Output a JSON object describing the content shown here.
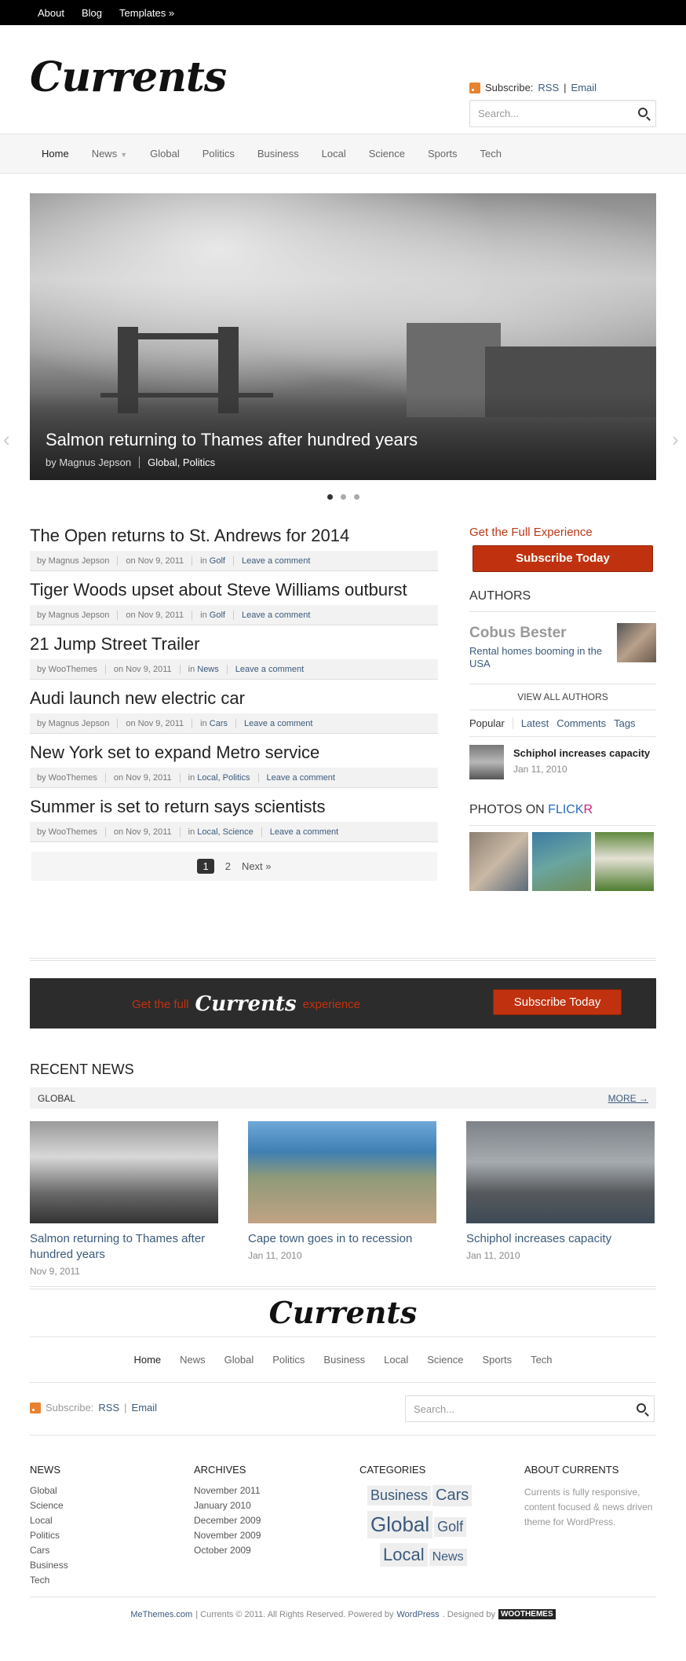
{
  "topbar": {
    "items": [
      "About",
      "Blog",
      "Templates »"
    ]
  },
  "header": {
    "logo": "Currents",
    "subscribe": "Subscribe:",
    "rss": "RSS",
    "email": "Email",
    "search_placeholder": "Search..."
  },
  "nav": {
    "items": [
      "Home",
      "News",
      "Global",
      "Politics",
      "Business",
      "Local",
      "Science",
      "Sports",
      "Tech"
    ]
  },
  "slider": {
    "title": "Salmon returning to Thames after hundred years",
    "author": "by Magnus Jepson",
    "cats": "Global, Politics"
  },
  "posts": [
    {
      "title": "The Open returns to St. Andrews for 2014",
      "author": "by Magnus Jepson",
      "date": "on Nov 9, 2011",
      "cat": "Golf",
      "comment": "Leave a comment"
    },
    {
      "title": "Tiger Woods upset about Steve Williams outburst",
      "author": "by Magnus Jepson",
      "date": "on Nov 9, 2011",
      "cat": "Golf",
      "comment": "Leave a comment"
    },
    {
      "title": "21 Jump Street Trailer",
      "author": "by WooThemes",
      "date": "on Nov 9, 2011",
      "cat": "News",
      "comment": "Leave a comment"
    },
    {
      "title": "Audi launch new electric car",
      "author": "by Magnus Jepson",
      "date": "on Nov 9, 2011",
      "cat": "Cars",
      "comment": "Leave a comment"
    },
    {
      "title": "New York set to expand Metro service",
      "author": "by WooThemes",
      "date": "on Nov 9, 2011",
      "cat": "Local, Politics",
      "comment": "Leave a comment"
    },
    {
      "title": "Summer is set to return says scientists",
      "author": "by WooThemes",
      "date": "on Nov 9, 2011",
      "cat": "Local, Science",
      "comment": "Leave a comment"
    }
  ],
  "pager": {
    "p1": "1",
    "p2": "2",
    "next": "Next »"
  },
  "sidebar": {
    "full": "Get the Full Experience",
    "subscribe_btn": "Subscribe Today",
    "authors_h": "AUTHORS",
    "author_name": "Cobus Bester",
    "author_desc": "Rental homes booming in the USA",
    "view_all": "VIEW ALL AUTHORS",
    "tabs": [
      "Popular",
      "Latest",
      "Comments",
      "Tags"
    ],
    "tab_post_title": "Schiphol increases capacity",
    "tab_post_date": "Jan 11, 2010",
    "photos_h": "PHOTOS ON",
    "flickr_fl": "FLICK",
    "flickr_r": "R"
  },
  "banner": {
    "pre": "Get the full",
    "logo": "Currents",
    "post": "experience",
    "btn": "Subscribe Today"
  },
  "recent": {
    "heading": "RECENT NEWS",
    "bar_left": "GLOBAL",
    "bar_right": "MORE →",
    "items": [
      {
        "title": "Salmon returning to Thames after hundred years",
        "date": "Nov 9, 2011"
      },
      {
        "title": "Cape town goes in to recession",
        "date": "Jan 11, 2010"
      },
      {
        "title": "Schiphol increases capacity",
        "date": "Jan 11, 2010"
      }
    ]
  },
  "footer": {
    "logo": "Currents",
    "subscribe": "Subscribe:",
    "rss": "RSS",
    "email": "Email",
    "search_placeholder": "Search...",
    "news_h": "NEWS",
    "news": [
      "Global",
      "Science",
      "Local",
      "Politics",
      "Cars",
      "Business",
      "Tech"
    ],
    "archives_h": "ARCHIVES",
    "archives": [
      "November 2011",
      "January 2010",
      "December 2009",
      "November 2009",
      "October 2009"
    ],
    "categories_h": "CATEGORIES",
    "tags": [
      "Business",
      "Cars",
      "Global",
      "Golf",
      "Local",
      "News"
    ],
    "about_h": "ABOUT CURRENTS",
    "about": "Currents is fully responsive, content focused & news driven theme for WordPress.",
    "copy1": "MeThemes.com",
    "copy2": "| Currents © 2011. All Rights Reserved. Powered by",
    "copy3": "WordPress",
    "copy4": ". Designed by",
    "woo": "WOOTHEMES"
  }
}
